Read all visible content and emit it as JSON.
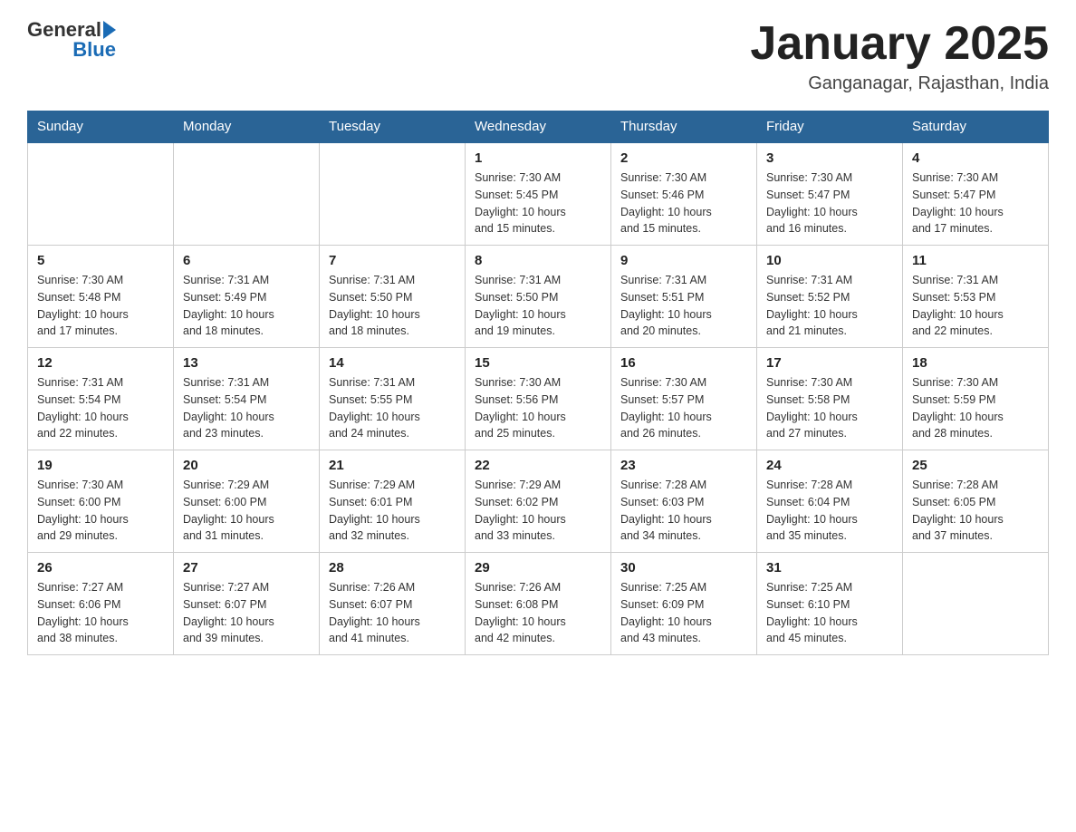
{
  "header": {
    "logo_general": "General",
    "logo_blue": "Blue",
    "month_title": "January 2025",
    "location": "Ganganagar, Rajasthan, India"
  },
  "days_of_week": [
    "Sunday",
    "Monday",
    "Tuesday",
    "Wednesday",
    "Thursday",
    "Friday",
    "Saturday"
  ],
  "weeks": [
    [
      {
        "num": "",
        "info": ""
      },
      {
        "num": "",
        "info": ""
      },
      {
        "num": "",
        "info": ""
      },
      {
        "num": "1",
        "info": "Sunrise: 7:30 AM\nSunset: 5:45 PM\nDaylight: 10 hours\nand 15 minutes."
      },
      {
        "num": "2",
        "info": "Sunrise: 7:30 AM\nSunset: 5:46 PM\nDaylight: 10 hours\nand 15 minutes."
      },
      {
        "num": "3",
        "info": "Sunrise: 7:30 AM\nSunset: 5:47 PM\nDaylight: 10 hours\nand 16 minutes."
      },
      {
        "num": "4",
        "info": "Sunrise: 7:30 AM\nSunset: 5:47 PM\nDaylight: 10 hours\nand 17 minutes."
      }
    ],
    [
      {
        "num": "5",
        "info": "Sunrise: 7:30 AM\nSunset: 5:48 PM\nDaylight: 10 hours\nand 17 minutes."
      },
      {
        "num": "6",
        "info": "Sunrise: 7:31 AM\nSunset: 5:49 PM\nDaylight: 10 hours\nand 18 minutes."
      },
      {
        "num": "7",
        "info": "Sunrise: 7:31 AM\nSunset: 5:50 PM\nDaylight: 10 hours\nand 18 minutes."
      },
      {
        "num": "8",
        "info": "Sunrise: 7:31 AM\nSunset: 5:50 PM\nDaylight: 10 hours\nand 19 minutes."
      },
      {
        "num": "9",
        "info": "Sunrise: 7:31 AM\nSunset: 5:51 PM\nDaylight: 10 hours\nand 20 minutes."
      },
      {
        "num": "10",
        "info": "Sunrise: 7:31 AM\nSunset: 5:52 PM\nDaylight: 10 hours\nand 21 minutes."
      },
      {
        "num": "11",
        "info": "Sunrise: 7:31 AM\nSunset: 5:53 PM\nDaylight: 10 hours\nand 22 minutes."
      }
    ],
    [
      {
        "num": "12",
        "info": "Sunrise: 7:31 AM\nSunset: 5:54 PM\nDaylight: 10 hours\nand 22 minutes."
      },
      {
        "num": "13",
        "info": "Sunrise: 7:31 AM\nSunset: 5:54 PM\nDaylight: 10 hours\nand 23 minutes."
      },
      {
        "num": "14",
        "info": "Sunrise: 7:31 AM\nSunset: 5:55 PM\nDaylight: 10 hours\nand 24 minutes."
      },
      {
        "num": "15",
        "info": "Sunrise: 7:30 AM\nSunset: 5:56 PM\nDaylight: 10 hours\nand 25 minutes."
      },
      {
        "num": "16",
        "info": "Sunrise: 7:30 AM\nSunset: 5:57 PM\nDaylight: 10 hours\nand 26 minutes."
      },
      {
        "num": "17",
        "info": "Sunrise: 7:30 AM\nSunset: 5:58 PM\nDaylight: 10 hours\nand 27 minutes."
      },
      {
        "num": "18",
        "info": "Sunrise: 7:30 AM\nSunset: 5:59 PM\nDaylight: 10 hours\nand 28 minutes."
      }
    ],
    [
      {
        "num": "19",
        "info": "Sunrise: 7:30 AM\nSunset: 6:00 PM\nDaylight: 10 hours\nand 29 minutes."
      },
      {
        "num": "20",
        "info": "Sunrise: 7:29 AM\nSunset: 6:00 PM\nDaylight: 10 hours\nand 31 minutes."
      },
      {
        "num": "21",
        "info": "Sunrise: 7:29 AM\nSunset: 6:01 PM\nDaylight: 10 hours\nand 32 minutes."
      },
      {
        "num": "22",
        "info": "Sunrise: 7:29 AM\nSunset: 6:02 PM\nDaylight: 10 hours\nand 33 minutes."
      },
      {
        "num": "23",
        "info": "Sunrise: 7:28 AM\nSunset: 6:03 PM\nDaylight: 10 hours\nand 34 minutes."
      },
      {
        "num": "24",
        "info": "Sunrise: 7:28 AM\nSunset: 6:04 PM\nDaylight: 10 hours\nand 35 minutes."
      },
      {
        "num": "25",
        "info": "Sunrise: 7:28 AM\nSunset: 6:05 PM\nDaylight: 10 hours\nand 37 minutes."
      }
    ],
    [
      {
        "num": "26",
        "info": "Sunrise: 7:27 AM\nSunset: 6:06 PM\nDaylight: 10 hours\nand 38 minutes."
      },
      {
        "num": "27",
        "info": "Sunrise: 7:27 AM\nSunset: 6:07 PM\nDaylight: 10 hours\nand 39 minutes."
      },
      {
        "num": "28",
        "info": "Sunrise: 7:26 AM\nSunset: 6:07 PM\nDaylight: 10 hours\nand 41 minutes."
      },
      {
        "num": "29",
        "info": "Sunrise: 7:26 AM\nSunset: 6:08 PM\nDaylight: 10 hours\nand 42 minutes."
      },
      {
        "num": "30",
        "info": "Sunrise: 7:25 AM\nSunset: 6:09 PM\nDaylight: 10 hours\nand 43 minutes."
      },
      {
        "num": "31",
        "info": "Sunrise: 7:25 AM\nSunset: 6:10 PM\nDaylight: 10 hours\nand 45 minutes."
      },
      {
        "num": "",
        "info": ""
      }
    ]
  ]
}
